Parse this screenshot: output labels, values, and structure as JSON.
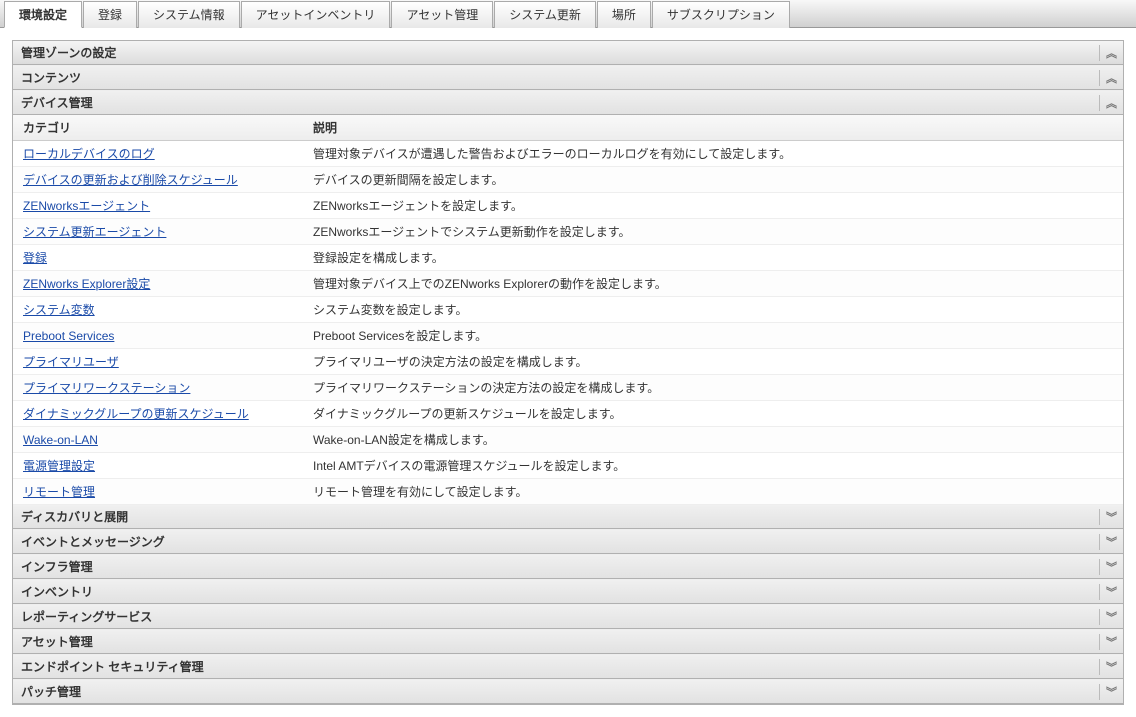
{
  "tabs": [
    {
      "label": "環境設定",
      "active": true
    },
    {
      "label": "登録",
      "active": false
    },
    {
      "label": "システム情報",
      "active": false
    },
    {
      "label": "アセットインベントリ",
      "active": false
    },
    {
      "label": "アセット管理",
      "active": false
    },
    {
      "label": "システム更新",
      "active": false
    },
    {
      "label": "場所",
      "active": false
    },
    {
      "label": "サブスクリプション",
      "active": false
    }
  ],
  "sections": {
    "zone": "管理ゾーンの設定",
    "contents": "コンテンツ",
    "device_mgmt": "デバイス管理"
  },
  "table": {
    "header_category": "カテゴリ",
    "header_description": "説明",
    "rows": [
      {
        "cat": "ローカルデバイスのログ",
        "desc": "管理対象デバイスが遭遇した警告およびエラーのローカルログを有効にして設定します。"
      },
      {
        "cat": "デバイスの更新および削除スケジュール",
        "desc": "デバイスの更新間隔を設定します。"
      },
      {
        "cat": "ZENworksエージェント",
        "desc": "ZENworksエージェントを設定します。"
      },
      {
        "cat": "システム更新エージェント",
        "desc": "ZENworksエージェントでシステム更新動作を設定します。"
      },
      {
        "cat": "登録",
        "desc": "登録設定を構成します。"
      },
      {
        "cat": "ZENworks Explorer設定",
        "desc": "管理対象デバイス上でのZENworks Explorerの動作を設定します。"
      },
      {
        "cat": "システム変数",
        "desc": "システム変数を設定します。"
      },
      {
        "cat": "Preboot Services",
        "desc": "Preboot Servicesを設定します。"
      },
      {
        "cat": "プライマリユーザ",
        "desc": "プライマリユーザの決定方法の設定を構成します。"
      },
      {
        "cat": "プライマリワークステーション",
        "desc": "プライマリワークステーションの決定方法の設定を構成します。"
      },
      {
        "cat": "ダイナミックグループの更新スケジュール",
        "desc": "ダイナミックグループの更新スケジュールを設定します。"
      },
      {
        "cat": "Wake-on-LAN",
        "desc": "Wake-on-LAN設定を構成します。"
      },
      {
        "cat": "電源管理設定",
        "desc": "Intel AMTデバイスの電源管理スケジュールを設定します。"
      },
      {
        "cat": "リモート管理",
        "desc": "リモート管理を有効にして設定します。"
      }
    ]
  },
  "collapsed_sections": [
    "ディスカバリと展開",
    "イベントとメッセージング",
    "インフラ管理",
    "インベントリ",
    "レポーティングサービス",
    "アセット管理",
    "エンドポイント セキュリティ管理",
    "パッチ管理"
  ],
  "icons": {
    "collapse_up": "︽",
    "expand_down": "︾"
  }
}
